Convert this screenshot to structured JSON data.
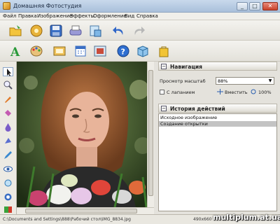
{
  "window": {
    "title": "Домашняя Фотостудия",
    "buttons": {
      "minimize": "_",
      "maximize": "□",
      "close": "✕"
    }
  },
  "menu": [
    "Файл",
    "Правка",
    "Изображение",
    "Эффекты",
    "Оформление",
    "Вид",
    "Справка"
  ],
  "toolbar_top": [
    {
      "icon": "open-folder-icon"
    },
    {
      "icon": "image-browser-icon"
    },
    {
      "icon": "save-icon"
    },
    {
      "icon": "print-icon"
    },
    {
      "icon": "scanner-icon"
    },
    {
      "icon": "undo-icon"
    },
    {
      "icon": "redo-icon"
    }
  ],
  "toolbar_bottom": [
    {
      "icon": "text-tool-icon"
    },
    {
      "icon": "palette-icon"
    },
    {
      "icon": "frame-icon"
    },
    {
      "icon": "calendar-icon"
    },
    {
      "icon": "picture-icon"
    },
    {
      "icon": "help-icon"
    },
    {
      "icon": "box-icon"
    },
    {
      "icon": "bag-icon"
    }
  ],
  "left_tools": [
    "pointer-icon",
    "zoom-icon",
    "brush-icon",
    "eraser-icon",
    "drop-icon",
    "fill-icon",
    "pencil-icon",
    "eye-icon",
    "redeye-icon",
    "color-icon",
    "exit-icon"
  ],
  "navigation": {
    "title": "Навигация",
    "scale_label": "Просмотр масштаб",
    "scale_value": "88%",
    "fit_label": "С лапанием",
    "fit_button": "Вместить",
    "actual_button": "100%"
  },
  "history": {
    "title": "История действий",
    "items": [
      "Исходное изображение",
      "Создание открытки"
    ],
    "active_index": 1
  },
  "status": {
    "path": "C:\\Documents and Settings\\888\\Рабочий стол\\IMG_8834.jpg",
    "size": "490x660"
  },
  "watermark": "multiplum.at.ua",
  "colors": {
    "accent": "#a9c0db",
    "history_selected": "#c3c3c3"
  }
}
